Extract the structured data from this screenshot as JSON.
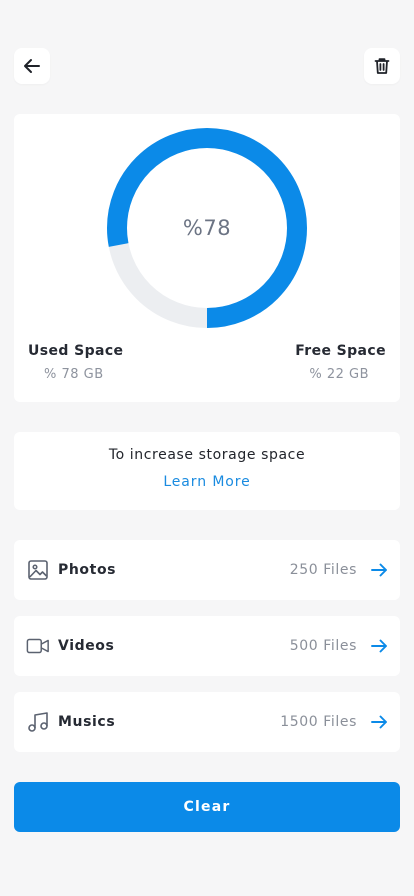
{
  "colors": {
    "accent": "#0b8ae8",
    "link": "#1a8be0",
    "ring_track": "#eceef1",
    "background": "#f6f6f7"
  },
  "header": {
    "back_icon": "arrow-left-icon",
    "delete_icon": "trash-icon"
  },
  "storage": {
    "used_fraction": 0.78,
    "percent_label": "%78",
    "used_title": "Used Space",
    "used_value": "% 78 GB",
    "free_title": "Free Space",
    "free_value": "% 22 GB"
  },
  "info": {
    "text": "To increase storage space",
    "link": "Learn More"
  },
  "categories": [
    {
      "icon": "image-icon",
      "label": "Photos",
      "count": "250 Files"
    },
    {
      "icon": "video-camera-icon",
      "label": "Videos",
      "count": "500 Files"
    },
    {
      "icon": "music-note-icon",
      "label": "Musics",
      "count": "1500 Files"
    }
  ],
  "actions": {
    "clear": "Clear"
  }
}
